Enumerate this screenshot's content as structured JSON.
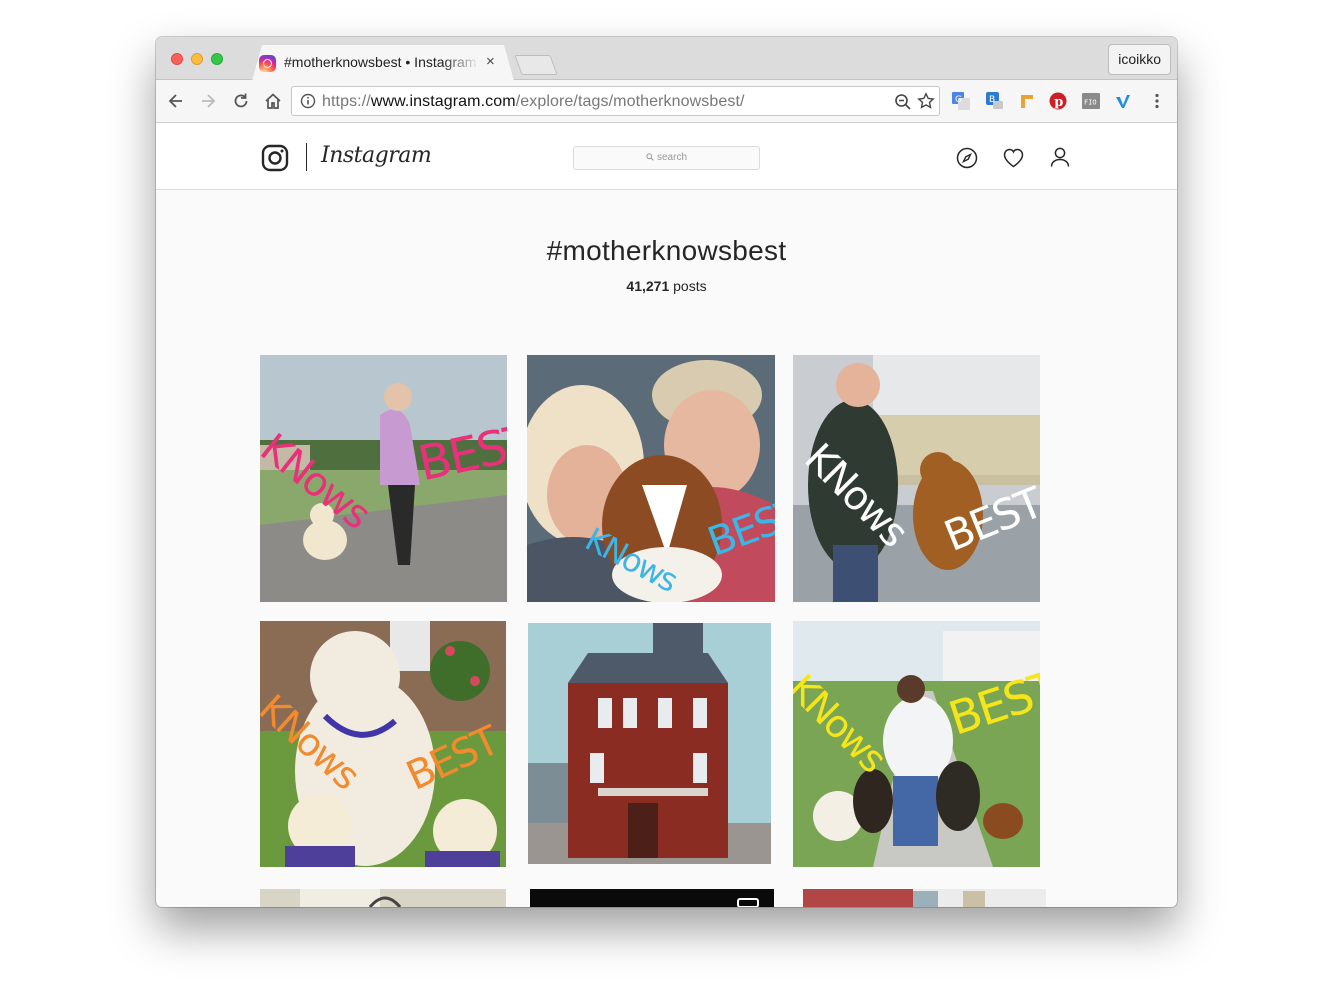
{
  "browser": {
    "tab_title": "#motherknowsbest • Instagram",
    "profile_name": "icoikko",
    "url_scheme": "https://",
    "url_domain": "www.instagram.com",
    "url_path": "/explore/tags/motherknowsbest/",
    "tab_close_glyph": "×"
  },
  "instagram": {
    "wordmark": "Instagram",
    "search_placeholder": "search",
    "nav_icons": [
      "compass-icon",
      "heart-icon",
      "user-icon"
    ]
  },
  "tag": {
    "title": "#motherknowsbest",
    "post_count": "41,271",
    "post_label": "posts"
  },
  "posts": [
    {
      "overlay_line1": "KNows",
      "overlay_line2": "BEST",
      "overlay_color": "#e8317a"
    },
    {
      "overlay_line1": "KNows",
      "overlay_line2": "BEST",
      "overlay_color": "#3cb6e6"
    },
    {
      "overlay_line1": "KNows",
      "overlay_line2": "BEST",
      "overlay_color": "#ffffff"
    },
    {
      "overlay_line1": "KNows",
      "overlay_line2": "BEST",
      "overlay_color": "#f28a2e"
    },
    {
      "overlay_line1": "",
      "overlay_line2": "",
      "overlay_color": ""
    },
    {
      "overlay_line1": "KNows",
      "overlay_line2": "BEST",
      "overlay_color": "#f5e51a"
    }
  ],
  "colors": {
    "ig_text": "#262626",
    "page_bg": "#fafafa",
    "border": "#dbdbdb"
  }
}
